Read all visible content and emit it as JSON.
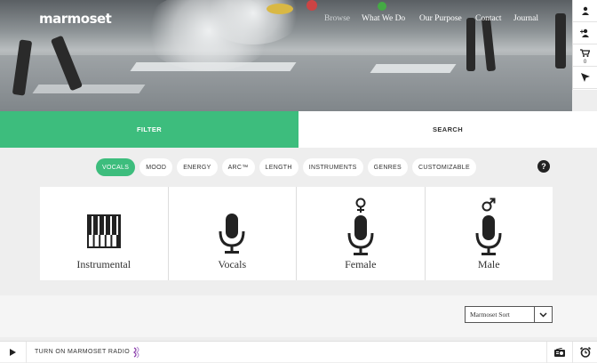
{
  "brand": {
    "logo": "marmoset"
  },
  "nav": {
    "items": [
      "Browse",
      "What We Do",
      "Our Purpose",
      "Contact",
      "Journal"
    ]
  },
  "sidebar": {
    "icons": [
      "user-icon",
      "add-user-icon",
      "cart-icon",
      "cursor-icon"
    ],
    "cart_count": "0"
  },
  "tabs": {
    "filter": "FILTER",
    "search": "SEARCH"
  },
  "filters": {
    "chips": [
      "VOCALS",
      "MOOD",
      "ENERGY",
      "ARC™",
      "LENGTH",
      "INSTRUMENTS",
      "GENRES",
      "CUSTOMIZABLE"
    ],
    "active": "VOCALS",
    "help": "?"
  },
  "vocal_options": [
    "Instrumental",
    "Vocals",
    "Female",
    "Male"
  ],
  "sort": {
    "selected": "Marmoset Sort"
  },
  "player": {
    "radio_label": "TURN ON MARMOSET RADIO"
  },
  "colors": {
    "accent": "#3dbd7d",
    "wave": "#8e44ad"
  }
}
